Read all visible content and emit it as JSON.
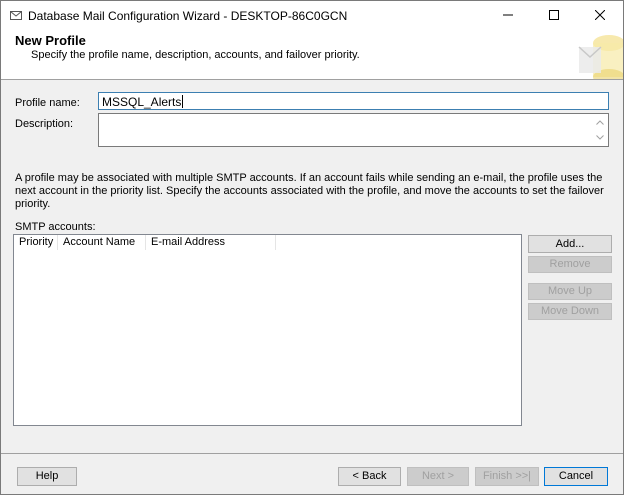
{
  "window": {
    "title": "Database Mail Configuration Wizard - DESKTOP-86C0GCN"
  },
  "header": {
    "title": "New Profile",
    "subtitle": "Specify the profile name, description, accounts, and failover priority."
  },
  "form": {
    "profile_name_label": "Profile name:",
    "profile_name_value": "MSSQL_Alerts",
    "description_label": "Description:",
    "description_value": ""
  },
  "info_text": "A profile may be associated with multiple SMTP accounts. If an account fails while sending an e-mail, the profile uses the next account in the priority list. Specify the accounts associated with the profile, and move the accounts to set the failover priority.",
  "smtp": {
    "label": "SMTP accounts:",
    "columns": [
      "Priority",
      "Account Name",
      "E-mail Address"
    ],
    "rows": []
  },
  "side_buttons": {
    "add": "Add...",
    "remove": "Remove",
    "move_up": "Move Up",
    "move_down": "Move Down"
  },
  "footer": {
    "help": "Help",
    "back": "< Back",
    "next": "Next >",
    "finish": "Finish >>|",
    "cancel": "Cancel"
  },
  "icons": {
    "app": "database-mail-icon",
    "logo": "database-wizard-logo-icon"
  }
}
